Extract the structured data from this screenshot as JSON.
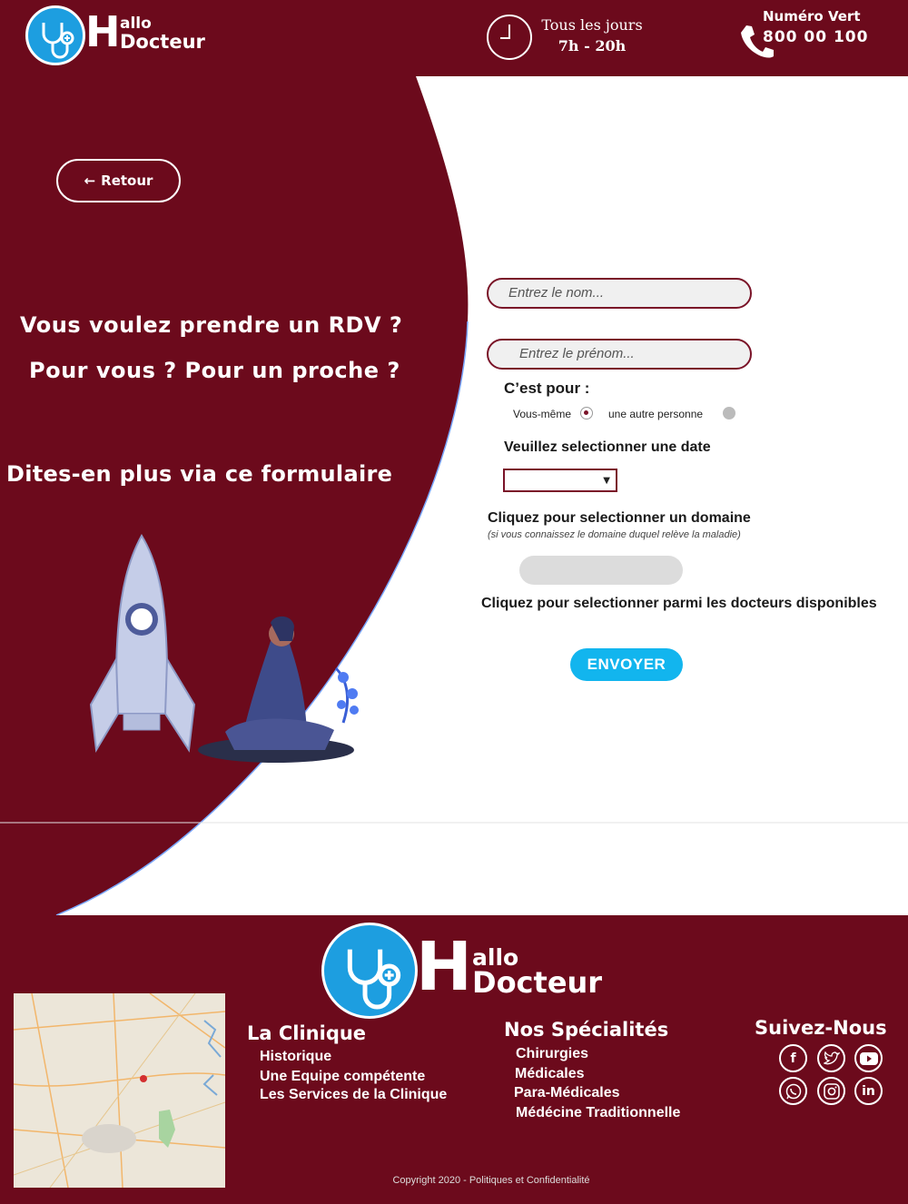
{
  "header": {
    "logo_top": "allo",
    "logo_bottom": "Docteur",
    "logo_letter": "H",
    "hours_line1": "Tous les jours",
    "hours_line2": "7h - 20h",
    "phone_label": "Numéro Vert",
    "phone_number": "800 00 100"
  },
  "hero": {
    "back_label": "Retour",
    "title_line1": "Vous voulez prendre un RDV ?",
    "title_line2": "Pour vous ? Pour un proche ?",
    "title_line3": "Dites-en plus via ce formulaire"
  },
  "form": {
    "name_placeholder": "Entrez le nom...",
    "firstname_placeholder": "Entrez le prénom...",
    "for_label": "C’est pour :",
    "option_self": "Vous-même",
    "option_other": "une autre personne",
    "date_label": "Veuillez selectionner une date",
    "domain_label": "Cliquez pour selectionner un domaine",
    "domain_hint": "(si vous connaissez le domaine duquel relève la maladie)",
    "doctor_label": "Cliquez pour selectionner parmi les docteurs disponibles",
    "submit_label": "ENVOYER"
  },
  "footer": {
    "logo_top": "allo",
    "logo_bottom": "Docteur",
    "logo_letter": "H",
    "clinic_title": "La Clinique",
    "clinic_items": [
      "Historique",
      "Une Equipe compétente",
      "Les Services de la Clinique"
    ],
    "spec_title": "Nos Spécialités",
    "spec_items": [
      "Chirurgies",
      "Médicales",
      "Para-Médicales",
      "Médécine Traditionnelle"
    ],
    "social_title": "Suivez-Nous",
    "social_icons": [
      "facebook-icon",
      "twitter-icon",
      "youtube-icon",
      "whatsapp-icon",
      "instagram-icon",
      "linkedin-icon"
    ],
    "copyright": "Copyright 2020 - Politiques et Confidentialité"
  },
  "colors": {
    "brand": "#6c0a1c",
    "accent": "#12b5ee",
    "logo_blue": "#1d9ee0"
  }
}
